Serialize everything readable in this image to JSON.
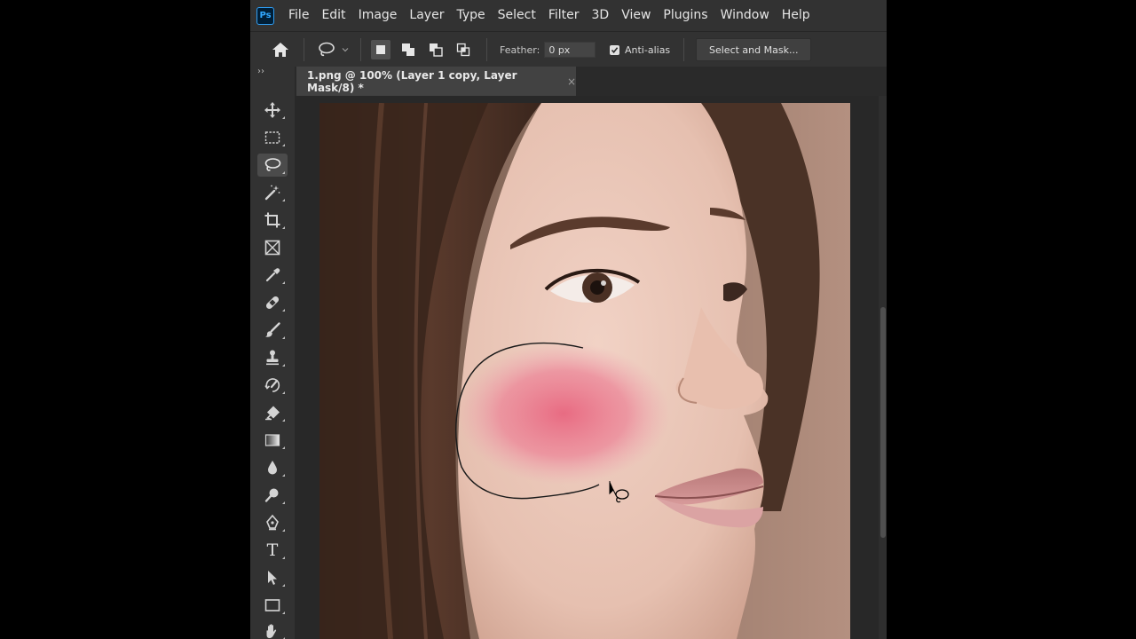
{
  "app": {
    "logo_text": "Ps",
    "accent_color": "#31a8ff"
  },
  "menu": {
    "items": [
      "File",
      "Edit",
      "Image",
      "Layer",
      "Type",
      "Select",
      "Filter",
      "3D",
      "View",
      "Plugins",
      "Window",
      "Help"
    ]
  },
  "options": {
    "home_icon": "home-icon",
    "tool_icon": "lasso-icon",
    "selection_modes": [
      "new-selection",
      "add-to-selection",
      "subtract-from-selection",
      "intersect-with-selection"
    ],
    "active_mode": "new-selection",
    "feather_label": "Feather:",
    "feather_value": "0 px",
    "antialias_label": "Anti-alias",
    "antialias_checked": true,
    "select_mask_label": "Select and Mask..."
  },
  "document": {
    "tab_title": "1.png @ 100% (Layer 1 copy, Layer Mask/8) *",
    "close_glyph": "×"
  },
  "toolbar": {
    "collapse_glyph": "››",
    "tools": [
      {
        "name": "move-tool",
        "icon": "move-icon"
      },
      {
        "name": "marquee-tool",
        "icon": "marquee-icon"
      },
      {
        "name": "lasso-tool",
        "icon": "lasso-icon",
        "active": true
      },
      {
        "name": "magic-wand-tool",
        "icon": "magic-wand-icon"
      },
      {
        "name": "crop-tool",
        "icon": "crop-icon"
      },
      {
        "name": "frame-tool",
        "icon": "frame-icon"
      },
      {
        "name": "eyedropper-tool",
        "icon": "eyedropper-icon"
      },
      {
        "name": "healing-brush-tool",
        "icon": "bandage-icon"
      },
      {
        "name": "brush-tool",
        "icon": "brush-icon"
      },
      {
        "name": "clone-stamp-tool",
        "icon": "stamp-icon"
      },
      {
        "name": "history-brush-tool",
        "icon": "history-brush-icon"
      },
      {
        "name": "eraser-tool",
        "icon": "eraser-icon"
      },
      {
        "name": "gradient-tool",
        "icon": "gradient-icon"
      },
      {
        "name": "blur-tool",
        "icon": "drop-icon"
      },
      {
        "name": "dodge-tool",
        "icon": "dodge-icon"
      },
      {
        "name": "pen-tool",
        "icon": "pen-icon"
      },
      {
        "name": "type-tool",
        "icon": "type-icon",
        "glyph": "T"
      },
      {
        "name": "path-selection-tool",
        "icon": "arrow-icon"
      },
      {
        "name": "rectangle-tool",
        "icon": "rectangle-icon"
      },
      {
        "name": "hand-tool",
        "icon": "hand-icon"
      }
    ]
  },
  "canvas": {
    "image_subject": "portrait-photo",
    "blush_color": "#e8667f"
  }
}
